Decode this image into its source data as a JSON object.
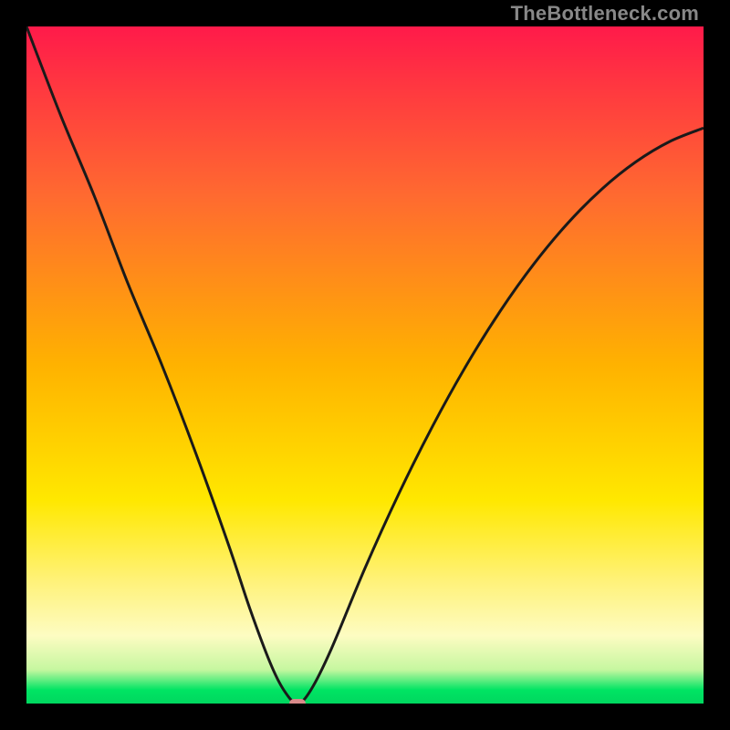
{
  "watermark": "TheBottleneck.com",
  "colors": {
    "background": "#000000",
    "curve_stroke": "#1a1a1a",
    "marker_fill": "#d98a8a"
  },
  "chart_data": {
    "type": "line",
    "title": "",
    "xlabel": "",
    "ylabel": "",
    "xlim": [
      0,
      100
    ],
    "ylim": [
      0,
      100
    ],
    "grid": false,
    "legend": false,
    "description": "V-shaped bottleneck curve descending from top-left to a minimum near x≈40 then rising to the right edge.",
    "series": [
      {
        "name": "bottleneck-curve",
        "x": [
          0,
          5,
          10,
          15,
          20,
          25,
          30,
          33,
          36,
          38,
          40,
          42,
          45,
          50,
          55,
          60,
          65,
          70,
          75,
          80,
          85,
          90,
          95,
          100
        ],
        "y": [
          100,
          87,
          75,
          62,
          50,
          37,
          23,
          14,
          6,
          2,
          0,
          2,
          8,
          20,
          31,
          41,
          50,
          58,
          65,
          71,
          76,
          80,
          83,
          85
        ]
      }
    ],
    "turning_point": {
      "x": 40,
      "y": 0
    }
  }
}
